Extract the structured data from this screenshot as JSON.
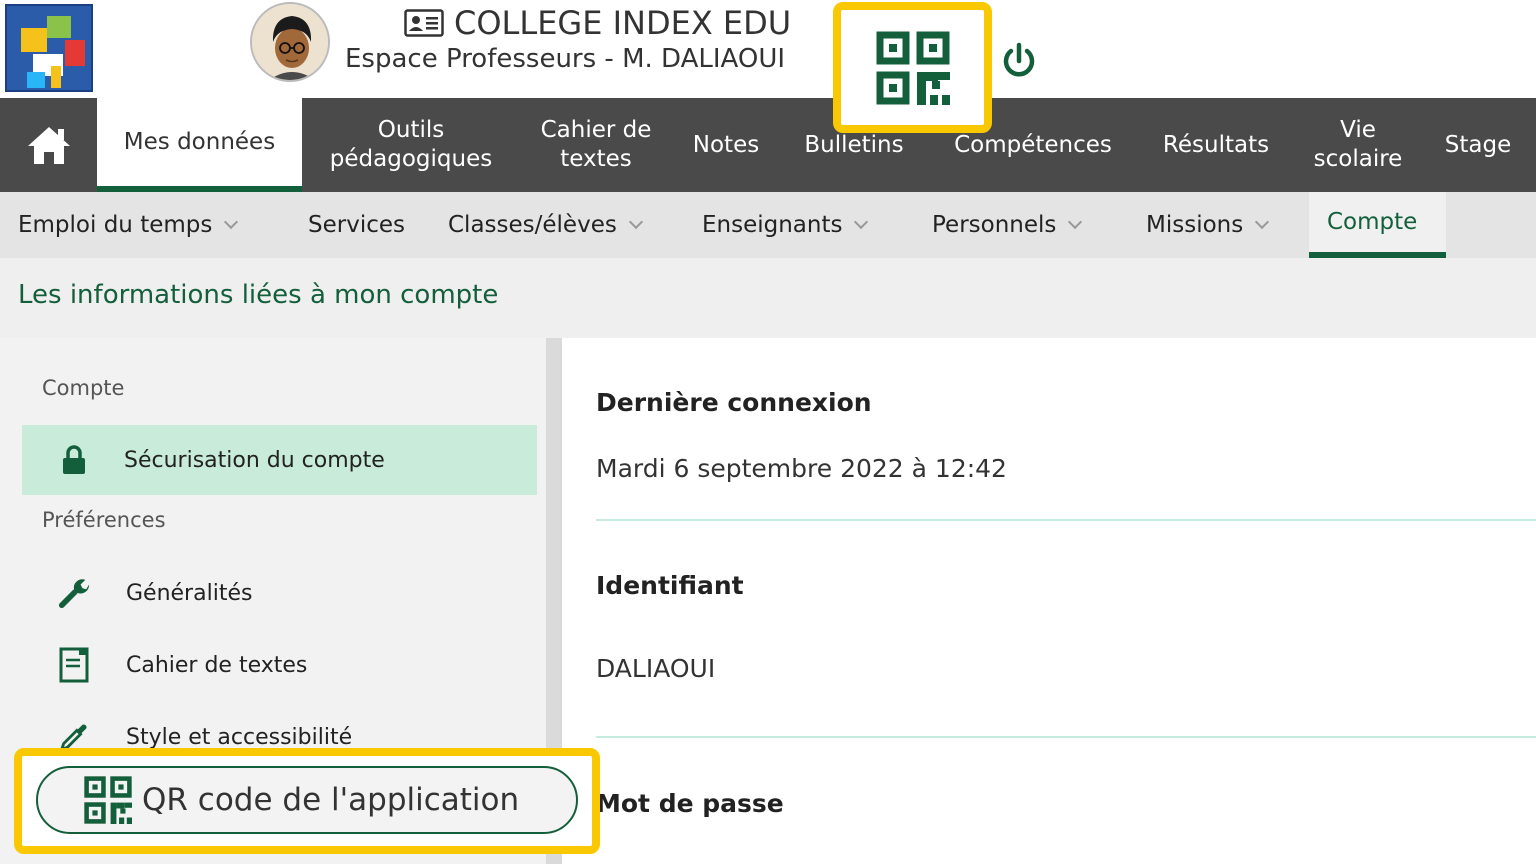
{
  "header": {
    "school_name": "COLLEGE INDEX EDU",
    "subtitle": "Espace Professeurs - M. DALIAOUI"
  },
  "main_nav": {
    "items": [
      {
        "label": "Mes données"
      },
      {
        "label": "Outils pédagogiques"
      },
      {
        "label": "Cahier de textes"
      },
      {
        "label": "Notes"
      },
      {
        "label": "Bulletins"
      },
      {
        "label": "Compétences"
      },
      {
        "label": "Résultats"
      },
      {
        "label": "Vie scolaire"
      },
      {
        "label": "Stage"
      }
    ]
  },
  "sub_nav": {
    "items": [
      {
        "label": "Emploi du temps"
      },
      {
        "label": "Services"
      },
      {
        "label": "Classes/élèves"
      },
      {
        "label": "Enseignants"
      },
      {
        "label": "Personnels"
      },
      {
        "label": "Missions"
      },
      {
        "label": "Compte"
      }
    ]
  },
  "page_title": "Les informations liées à mon compte",
  "sidebar": {
    "section_account": "Compte",
    "section_prefs": "Préférences",
    "items": [
      {
        "label": "Sécurisation du compte",
        "icon": "lock-icon"
      },
      {
        "label": "Généralités",
        "icon": "wrench-icon"
      },
      {
        "label": "Cahier de textes",
        "icon": "notebook-icon"
      },
      {
        "label": "Style et accessibilité",
        "icon": "eyedropper-icon"
      }
    ],
    "qr_button_label": "QR code de l'application"
  },
  "content": {
    "last_login_label": "Dernière connexion",
    "last_login_value": "Mardi 6 septembre 2022 à 12:42",
    "identifier_label": "Identifiant",
    "identifier_value": "DALIAOUI",
    "password_label": "Mot de passe"
  },
  "colors": {
    "brand_green": "#145f3b",
    "nav_dark": "#4a4a4a",
    "highlight_yellow": "#f9c800",
    "active_item_bg": "#c8ecd9"
  }
}
